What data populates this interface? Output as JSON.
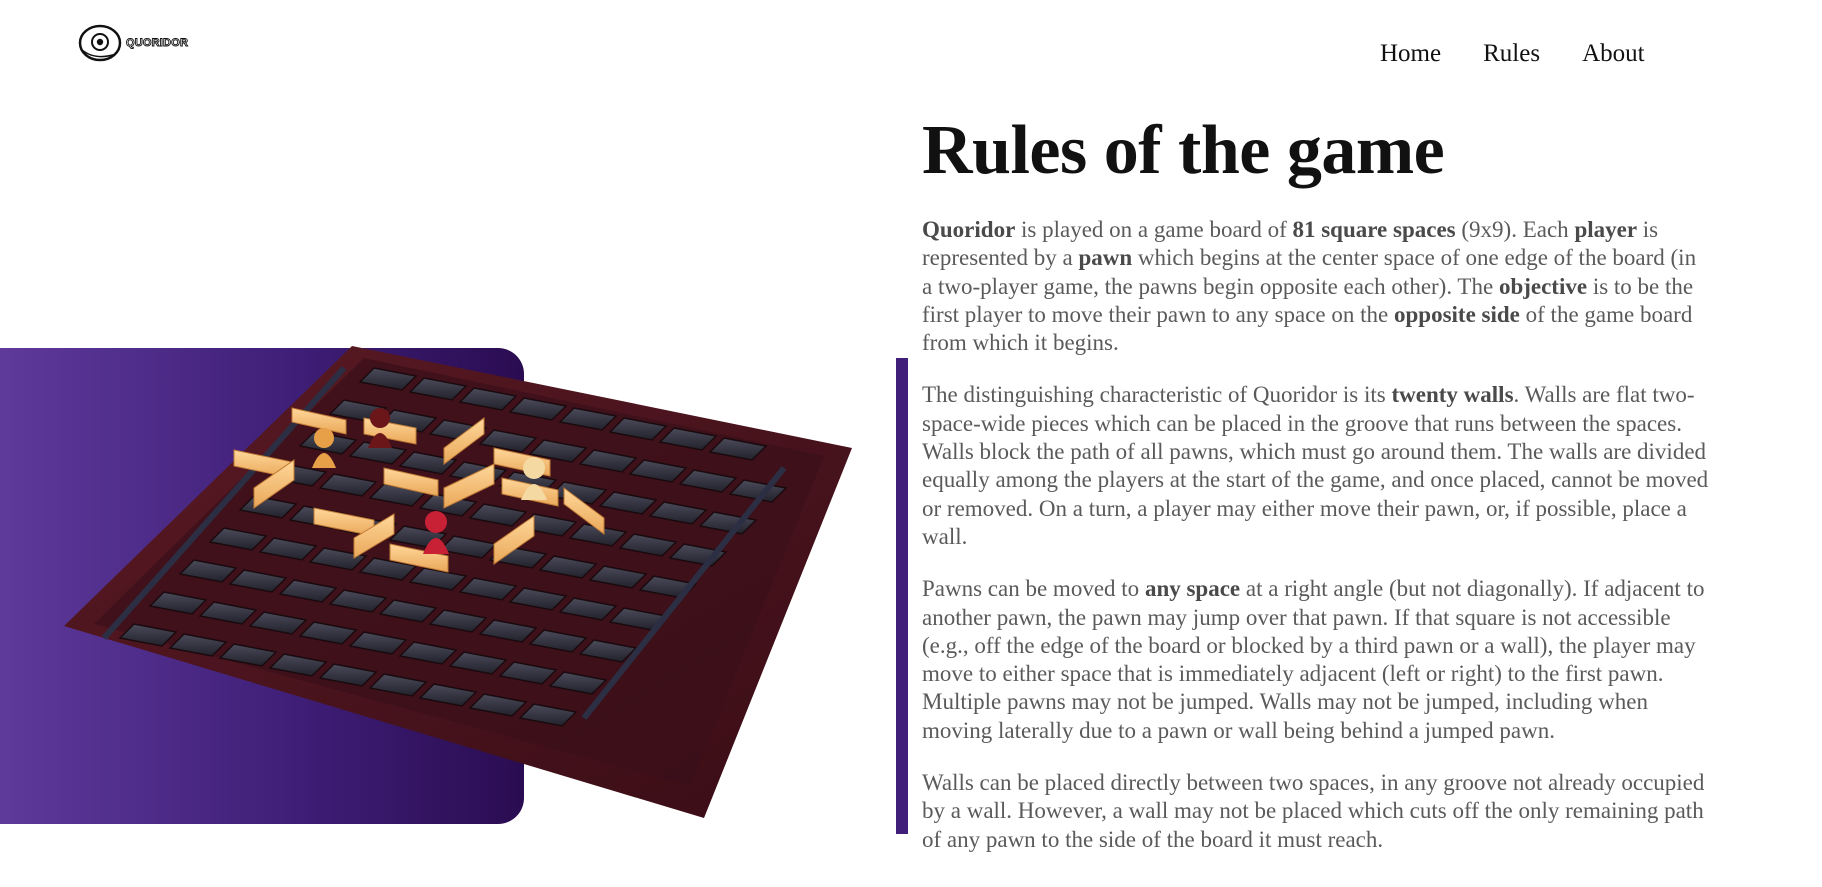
{
  "header": {
    "logo_text": "QUORIDOR",
    "nav": [
      {
        "label": "Home"
      },
      {
        "label": "Rules"
      },
      {
        "label": "About"
      }
    ]
  },
  "main": {
    "title": "Rules of the game",
    "paragraphs": {
      "p1": {
        "a": "Quoridor",
        "b": " is played on a game board of ",
        "c": "81 square spaces",
        "d": " (9x9). Each ",
        "e": "player",
        "f": " is represented by a ",
        "g": "pawn",
        "h": " which begins at the center space of one edge of the board (in a two-player game, the pawns begin opposite each other). The ",
        "i": "objective",
        "j": " is to be the first player to move their pawn to any space on the ",
        "k": "opposite side",
        "l": " of the game board from which it begins."
      },
      "p2": {
        "a": "The distinguishing characteristic of Quoridor is its ",
        "b": "twenty walls",
        "c": ". Walls are flat two-space-wide pieces which can be placed in the groove that runs between the spaces. Walls block the path of all pawns, which must go around them. The walls are divided equally among the players at the start of the game, and once placed, cannot be moved or removed. On a turn, a player may either move their pawn, or, if possible, place a wall."
      },
      "p3": {
        "a": "Pawns can be moved to ",
        "b": "any space",
        "c": " at a right angle (but not diagonally). If adjacent to another pawn, the pawn may jump over that pawn. If that square is not accessible (e.g., off the edge of the board or blocked by a third pawn or a wall), the player may move to either space that is immediately adjacent (left or right) to the first pawn. Multiple pawns may not be jumped. Walls may not be jumped, including when moving laterally due to a pawn or wall being behind a jumped pawn."
      },
      "p4": {
        "a": "Walls can be placed directly between two spaces, in any groove not already occupied by a wall. However, a wall may not be placed which cuts off the only remaining path of any pawn to the side of the board it must reach."
      }
    }
  },
  "colors": {
    "accent": "#3f1f7a",
    "panel_gradient_start": "#5e3a9b",
    "panel_gradient_end": "#2a0c52"
  }
}
